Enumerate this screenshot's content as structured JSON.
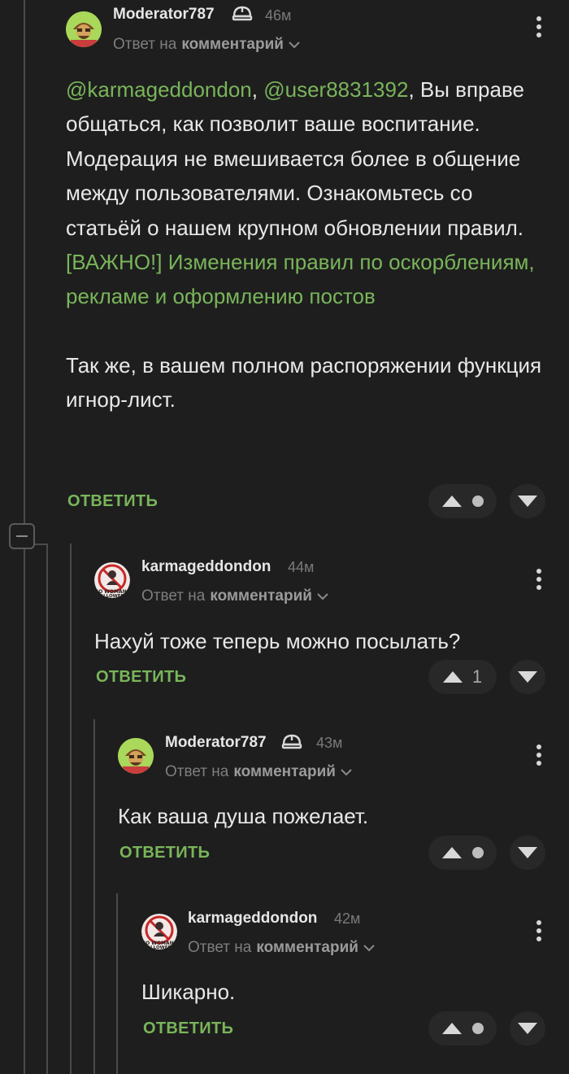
{
  "comments": [
    {
      "author": "Moderator787",
      "is_moderator": true,
      "time": "46м",
      "reply_prefix": "Ответ на",
      "reply_target": "комментарий",
      "mentions": [
        "@karmageddondon",
        "@user8831392"
      ],
      "mention_separator": ", ",
      "text_1": ", Вы вправе общаться, как позволит ваше воспитание. Модерация не вмешивается более в общение между пользователями. Ознакомьтесь со статьёй о нашем крупном обновлении правил.",
      "link": "[ВАЖНО!] Изменения правил по оскорблениям, рекламе и оформлению постов",
      "text_2": "Так же, в вашем полном распоряжении функция игнор-лист.",
      "reply_label": "ОТВЕТИТЬ",
      "score": ""
    },
    {
      "author": "karmageddondon",
      "is_moderator": false,
      "time": "44м",
      "reply_prefix": "Ответ на",
      "reply_target": "комментарий",
      "text": "Нахуй тоже теперь можно посылать?",
      "reply_label": "ОТВЕТИТЬ",
      "score": "1"
    },
    {
      "author": "Moderator787",
      "is_moderator": true,
      "time": "43м",
      "reply_prefix": "Ответ на",
      "reply_target": "комментарий",
      "text": "Как ваша душа пожелает.",
      "reply_label": "ОТВЕТИТЬ",
      "score": ""
    },
    {
      "author": "karmageddondon",
      "is_moderator": false,
      "time": "42м",
      "reply_prefix": "Ответ на",
      "reply_target": "комментарий",
      "text": "Шикарно.",
      "reply_label": "ОТВЕТИТЬ",
      "score": ""
    }
  ],
  "avatar_text": {
    "karmageddondon": "NO WOMANS ALLOWED"
  },
  "icons": {
    "moderator": "moderator-helmet-icon",
    "upvote": "triangle-up-icon",
    "downvote": "triangle-down-icon",
    "menu": "more-vertical-icon",
    "expand": "chevron-down-icon",
    "collapse": "minus-icon"
  },
  "colors": {
    "background": "#1e1e1e",
    "accent_green": "#79b55a",
    "text": "#e8e8e8",
    "muted": "#7a7a7a",
    "thread_line": "#4a4a4a"
  }
}
